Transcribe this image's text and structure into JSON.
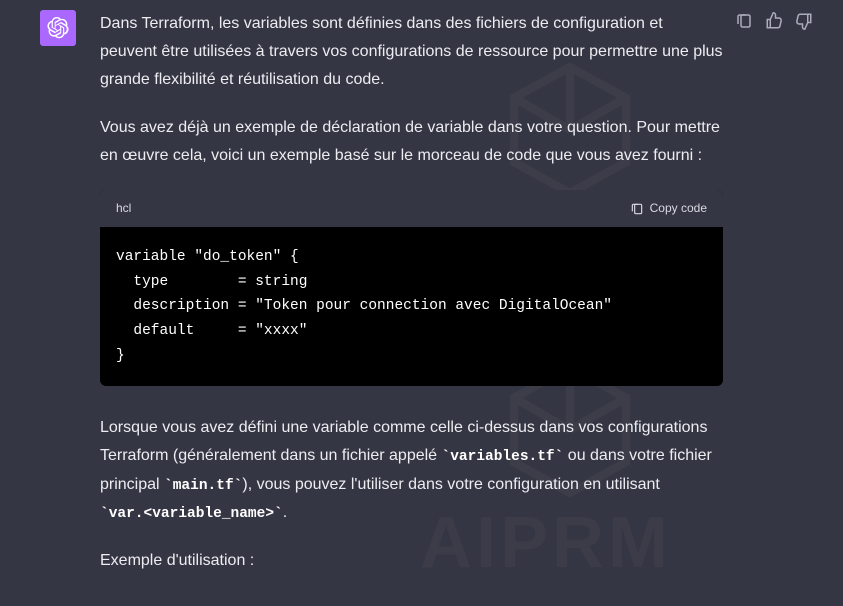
{
  "watermark": "AIPRM",
  "message": {
    "para1": "Dans Terraform, les variables sont définies dans des fichiers de configuration et peuvent être utilisées à travers vos configurations de ressource pour permettre une plus grande flexibilité et réutilisation du code.",
    "para2": "Vous avez déjà un exemple de déclaration de variable dans votre question. Pour mettre en œuvre cela, voici un exemple basé sur le morceau de code que vous avez fourni :",
    "code": {
      "language": "hcl",
      "copy_label": "Copy code",
      "body": "variable \"do_token\" {\n  type        = string\n  description = \"Token pour connection avec DigitalOcean\"\n  default     = \"xxxx\"\n}"
    },
    "para3_before": "Lorsque vous avez défini une variable comme celle ci-dessus dans vos configurations Terraform (généralement dans un fichier appelé ",
    "para3_code1": "variables.tf",
    "para3_mid1": " ou dans votre fichier principal ",
    "para3_code2": "main.tf",
    "para3_mid2": "), vous pouvez l'utiliser dans votre configuration en utilisant ",
    "para3_code3": "var.<variable_name>",
    "para3_after": ".",
    "para4": "Exemple d'utilisation :"
  },
  "icons": {
    "clipboard": "clipboard-icon",
    "thumbs_up": "thumbs-up-icon",
    "thumbs_down": "thumbs-down-icon"
  }
}
